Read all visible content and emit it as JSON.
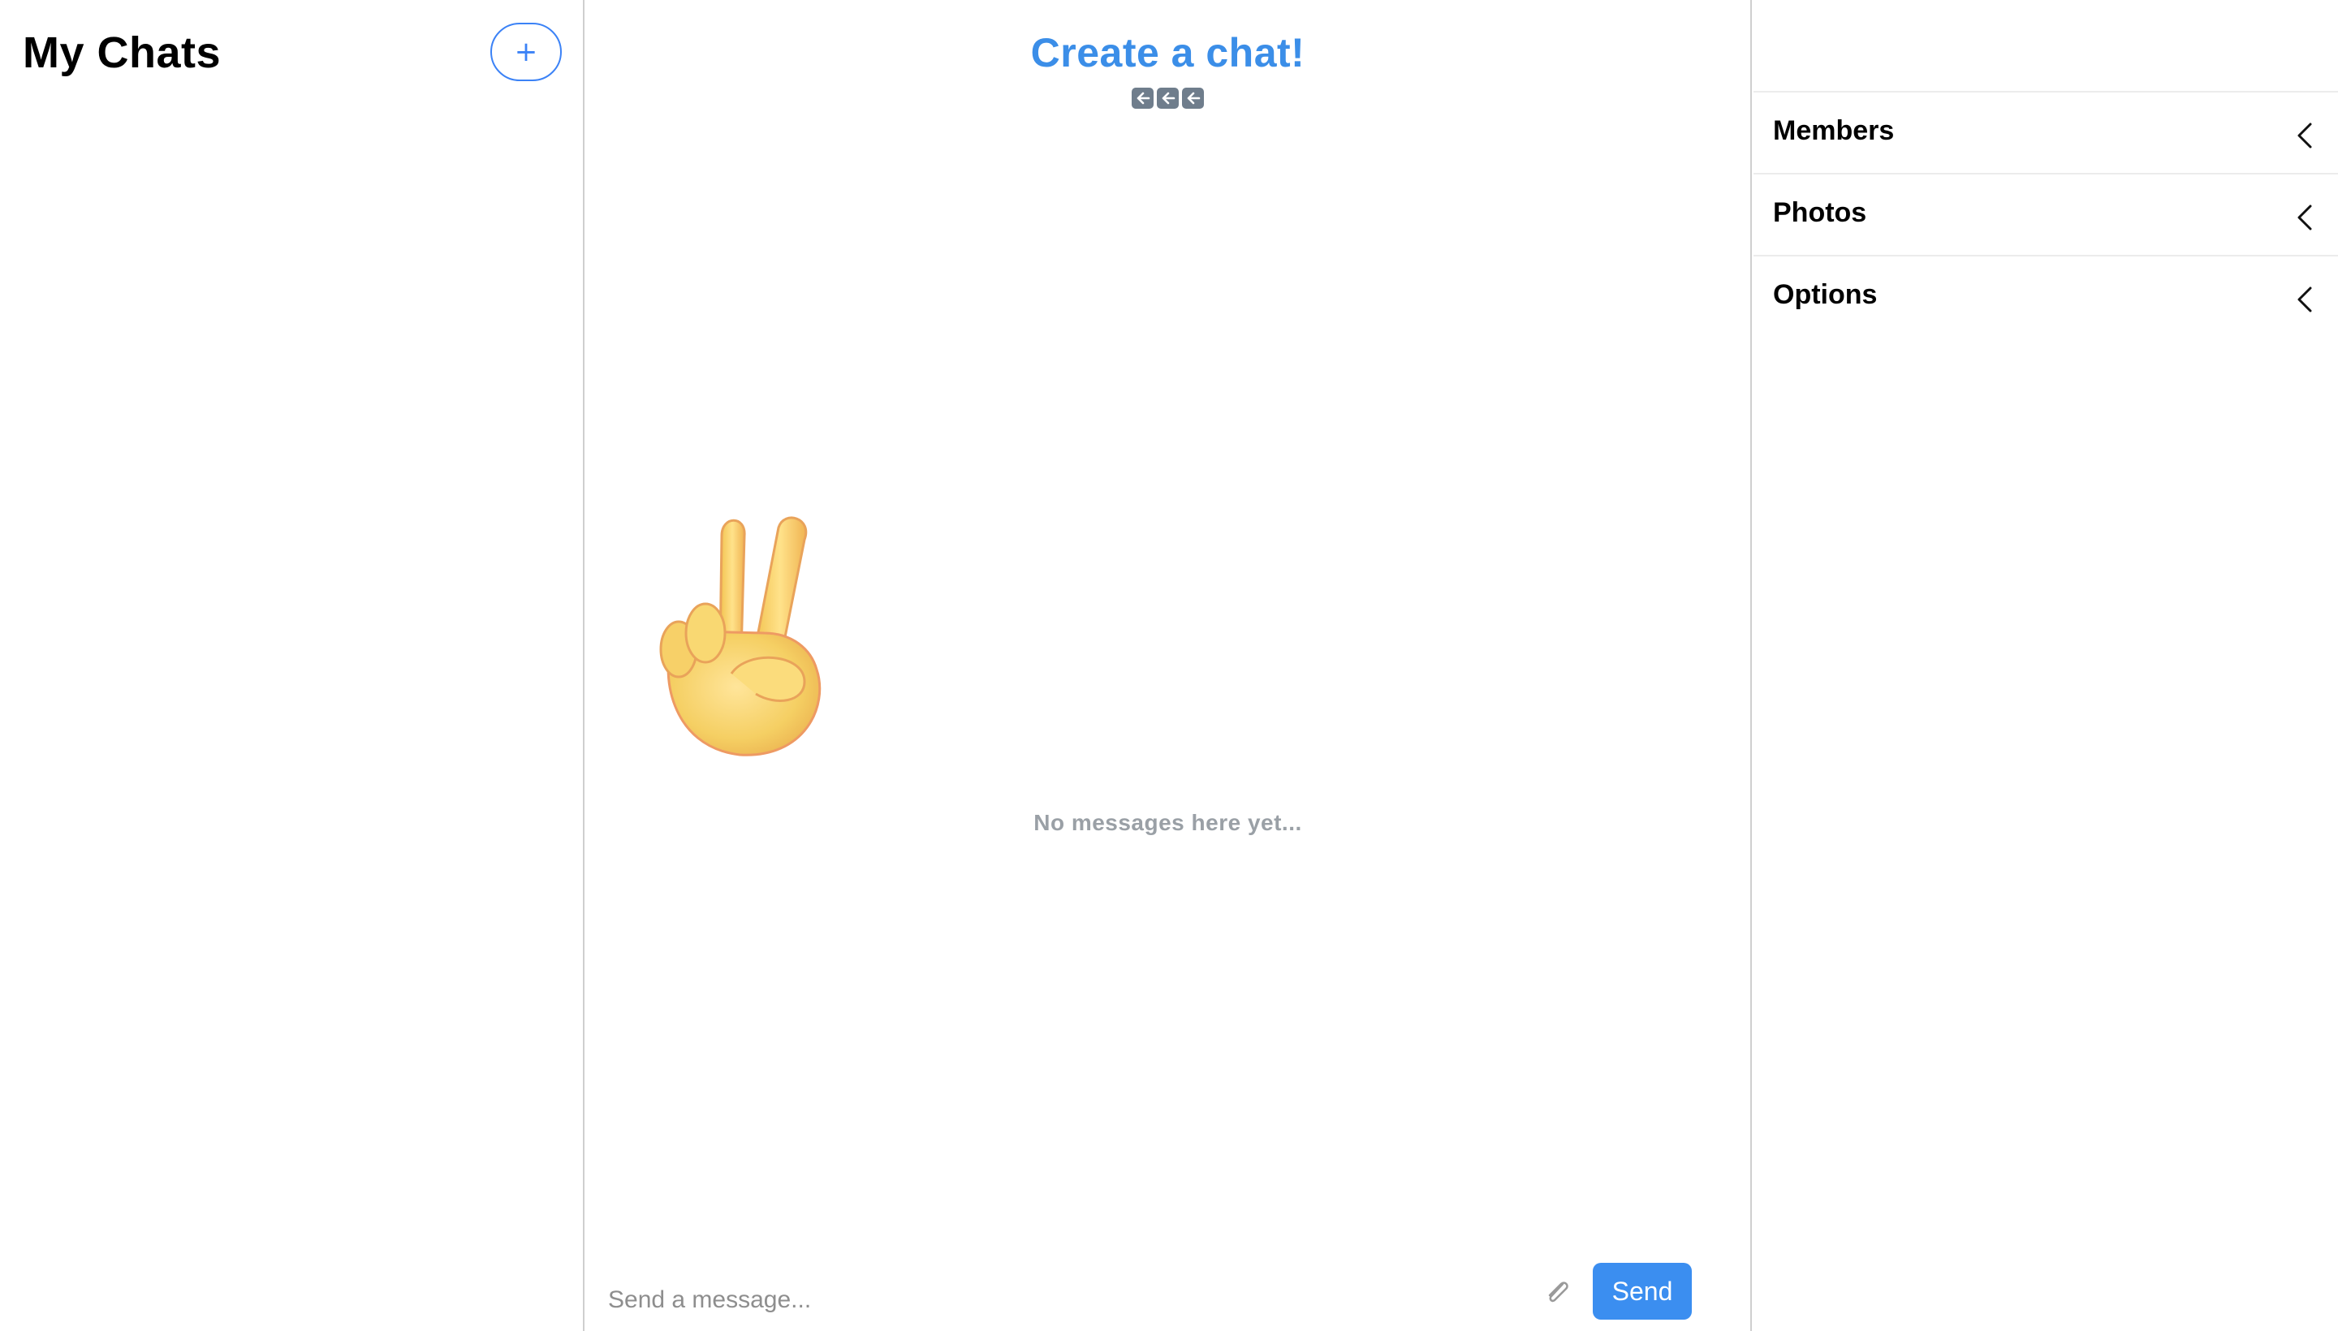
{
  "left_panel": {
    "title": "My Chats",
    "new_chat_button_label": "+"
  },
  "center_panel": {
    "title": "Create a chat!",
    "back_icons": [
      "arrow-left-key-icon",
      "arrow-left-key-icon",
      "arrow-left-key-icon"
    ],
    "empty_state_text": "No messages here yet...",
    "composer": {
      "placeholder": "Send a message...",
      "value": "",
      "send_label": "Send",
      "attach_icon": "paperclip-icon"
    },
    "illustration": "victory-hand-emoji"
  },
  "right_panel": {
    "sections": [
      {
        "label": "Members",
        "icon": "chevron-left-icon"
      },
      {
        "label": "Photos",
        "icon": "chevron-left-icon"
      },
      {
        "label": "Options",
        "icon": "chevron-left-icon"
      }
    ]
  },
  "colors": {
    "accent": "#3b8ee8",
    "send_button": "#3b8ef0",
    "muted_text": "#9aa0a6",
    "divider": "#cfcfcf"
  }
}
